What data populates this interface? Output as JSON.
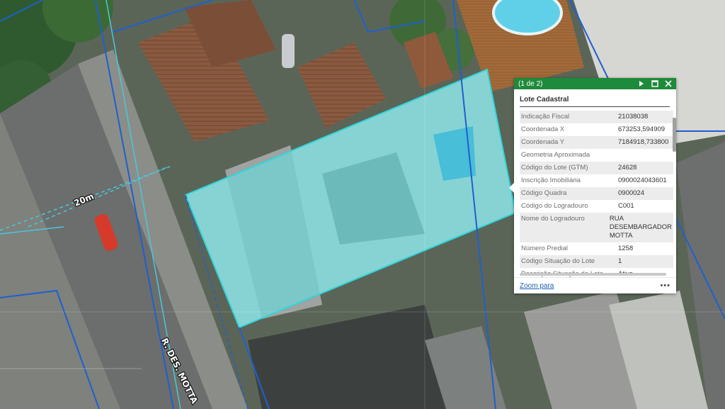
{
  "map": {
    "measure_label": "20m",
    "street_label": "R. DES. MOTTA"
  },
  "popup": {
    "counter": "(1 de 2)",
    "title": "Lote Cadastral",
    "attributes": [
      {
        "key": "Indicação Fiscal",
        "value": "21038038"
      },
      {
        "key": "Coordenada X",
        "value": "673253,594909"
      },
      {
        "key": "Coordenada Y",
        "value": "7184918,733800"
      },
      {
        "key": "Geometria Aproximada",
        "value": ""
      },
      {
        "key": "Código do Lote (GTM)",
        "value": "24628"
      },
      {
        "key": "Inscrição Imobiliária",
        "value": "0900024043601"
      },
      {
        "key": "Código Quadra",
        "value": "0900024"
      },
      {
        "key": "Código do Logradouro",
        "value": "C001"
      },
      {
        "key": "Nome do Logradouro",
        "value": "RUA DESEMBARGADOR MOTTA"
      },
      {
        "key": "Número Predial",
        "value": "1258"
      },
      {
        "key": "Código Situação do Lote",
        "value": "1"
      },
      {
        "key": "Descrição Situação do Lote",
        "value": "Ativo"
      }
    ],
    "zoom_label": "Zoom para",
    "more_label": "•••"
  },
  "colors": {
    "header": "#1e8a3b",
    "parcel_fill": "#5fe6ea",
    "parcel_outline": "#2fd6dc",
    "lot_lines": "#1f5fd0"
  },
  "icons": {
    "next": "next-arrow-icon",
    "maximize": "maximize-icon",
    "close": "close-icon",
    "more": "more-options-icon"
  }
}
